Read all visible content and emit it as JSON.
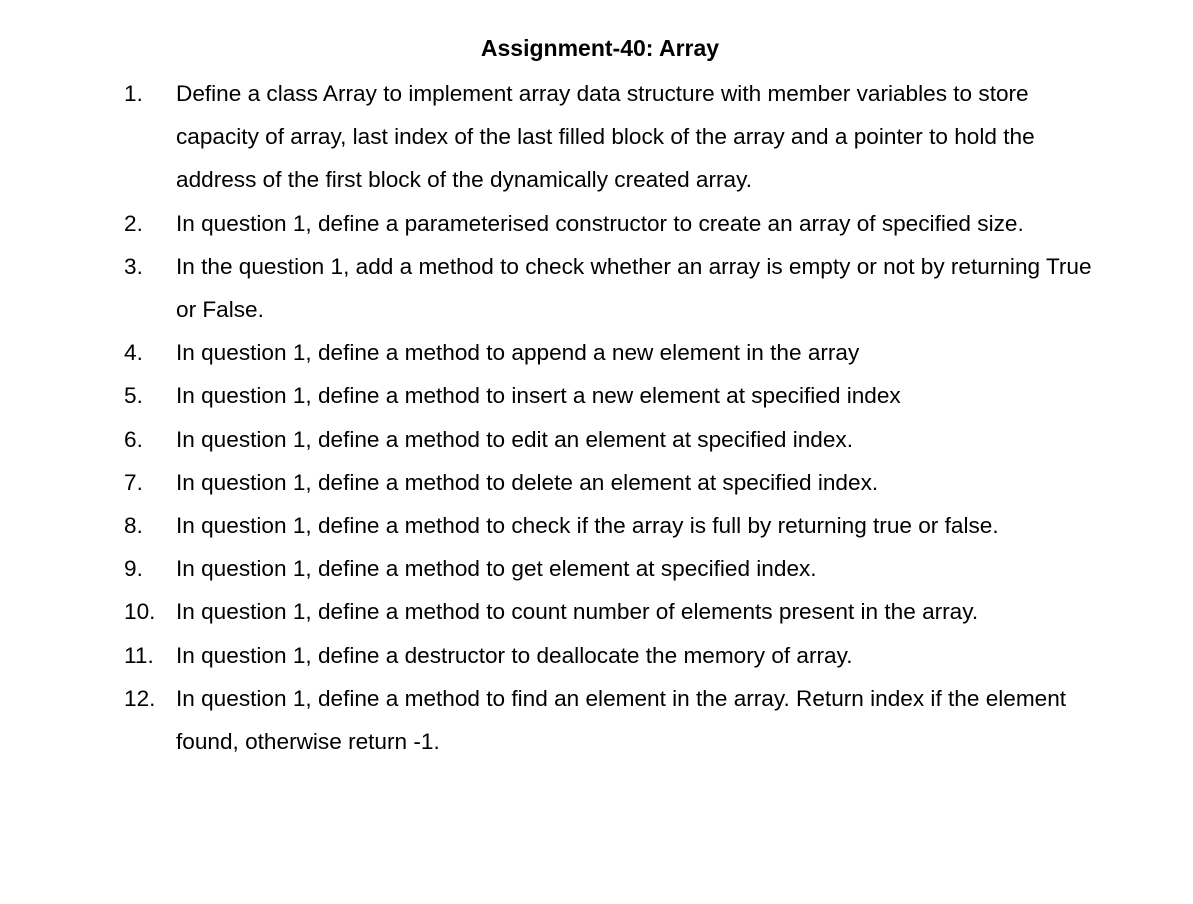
{
  "document": {
    "title": "Assignment-40: Array",
    "questions": [
      {
        "number": "1.",
        "text": "Define a class Array to implement array data structure with member variables to store capacity of array, last index of the last filled block of the array and a pointer to hold the address of the first block of the dynamically created array."
      },
      {
        "number": "2.",
        "text": "In question 1, define a parameterised constructor to create an array of specified size."
      },
      {
        "number": "3.",
        "text": "In the question 1, add a method to check whether an array is empty or not by returning True or False."
      },
      {
        "number": "4.",
        "text": "In question 1, define a method to append a new element in the array"
      },
      {
        "number": "5.",
        "text": "In question 1, define a method to insert a new element at specified index"
      },
      {
        "number": "6.",
        "text": "In question 1, define a method to edit an element at specified index."
      },
      {
        "number": "7.",
        "text": "In question 1, define a method to delete an element at specified index."
      },
      {
        "number": "8.",
        "text": "In question 1, define a method to check if the array is full by returning true or false."
      },
      {
        "number": "9.",
        "text": "In question 1, define a method to get element at specified index."
      },
      {
        "number": "10.",
        "text": "In question 1, define a method to count number of elements present in the array."
      },
      {
        "number": "11.",
        "text": "In question 1, define a destructor to deallocate the memory of array."
      },
      {
        "number": "12.",
        "text": "In question 1, define a method to find an element in the array. Return index if the element found, otherwise return -1."
      }
    ]
  }
}
